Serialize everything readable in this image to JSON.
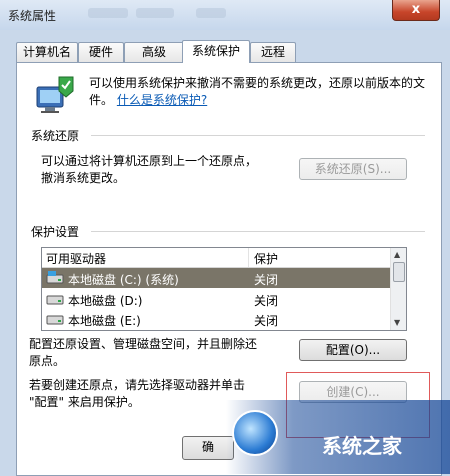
{
  "window": {
    "title": "系统属性",
    "close_label": "x"
  },
  "tabs": [
    {
      "label": "计算机名",
      "active": false
    },
    {
      "label": "硬件",
      "active": false
    },
    {
      "label": "高级",
      "active": false
    },
    {
      "label": "系统保护",
      "active": true
    },
    {
      "label": "远程",
      "active": false
    }
  ],
  "intro": {
    "text": "可以使用系统保护来撤消不需要的系统更改，还原以前版本的文件。",
    "link": "什么是系统保护?"
  },
  "restore": {
    "title": "系统还原",
    "desc_line1": "可以通过将计算机还原到上一个还原点，",
    "desc_line2": "撤消系统更改。",
    "button": "系统还原(S)..."
  },
  "protection": {
    "title": "保护设置",
    "col_drive": "可用驱动器",
    "col_protect": "保护",
    "rows": [
      {
        "name": "本地磁盘 (C:) (系统)",
        "state": "关闭",
        "selected": true
      },
      {
        "name": "本地磁盘 (D:)",
        "state": "关闭",
        "selected": false
      },
      {
        "name": "本地磁盘 (E:)",
        "state": "关闭",
        "selected": false
      }
    ]
  },
  "configure": {
    "desc_line1": "配置还原设置、管理磁盘空间，并且删除还",
    "desc_line2": "原点。",
    "button": "配置(O)..."
  },
  "create": {
    "desc_line1": "若要创建还原点，请先选择驱动器并单击",
    "desc_line2": "\"配置\" 来启用保护。",
    "button": "创建(C)..."
  },
  "footer": {
    "ok_label": "确"
  },
  "watermark": {
    "text": "系统之家"
  }
}
